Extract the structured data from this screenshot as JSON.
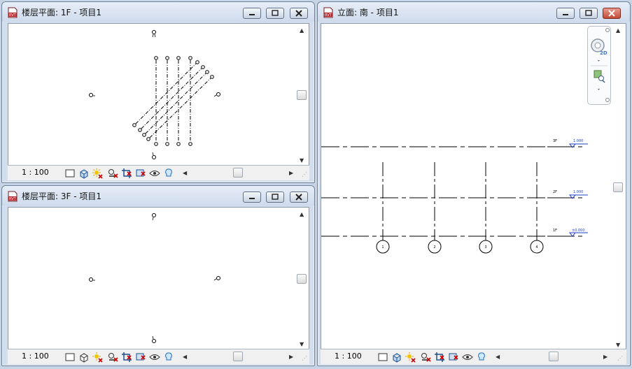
{
  "windows": {
    "plan_1f": {
      "title": "楼层平面: 1F - 项目1",
      "scale": "1 : 100"
    },
    "plan_3f": {
      "title": "楼层平面: 3F - 项目1",
      "scale": "1 : 100"
    },
    "elev_south": {
      "title": "立面: 南 - 项目1",
      "scale": "1 : 100",
      "nav_wheel_label": "2D",
      "levels": [
        {
          "name": "3F",
          "elevation": "1.000"
        },
        {
          "name": "2F",
          "elevation": "1.000"
        },
        {
          "name": "1F",
          "elevation": "±0.000"
        }
      ],
      "grids": [
        "1",
        "2",
        "3",
        "4"
      ]
    }
  },
  "view_controls": [
    "detail-level",
    "visual-style",
    "sun-path",
    "shadows",
    "crop-view",
    "show-crop-region",
    "temporary-hide",
    "reveal-hidden",
    "analytical-model"
  ],
  "colors": {
    "window_frame": "#d2dded",
    "close_active": "#c24a36",
    "level_marker": "#1a3cc8"
  }
}
